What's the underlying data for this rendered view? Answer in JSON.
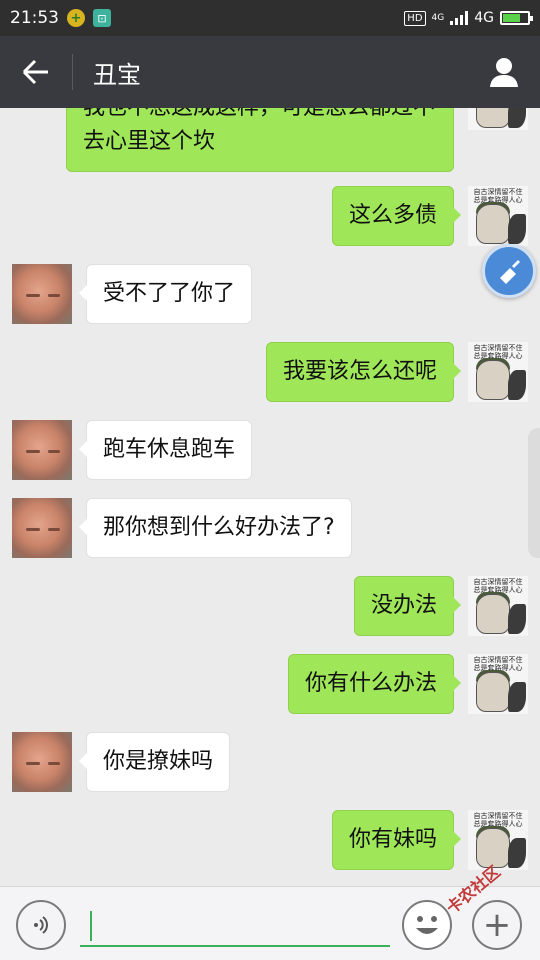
{
  "status_bar": {
    "time": "21:53",
    "hd": "HD",
    "network_small": "4G",
    "network": "4G",
    "battery_level": 0.7
  },
  "header": {
    "title": "丑宝",
    "back_icon": "arrow-left-icon",
    "profile_icon": "person-icon"
  },
  "meme_caption": "自古深情留不住 总是套路得人心",
  "messages": [
    {
      "side": "out",
      "text": "我也不想这成这样，可是怎么都过不去心里这个坎"
    },
    {
      "side": "out",
      "text": "这么多债"
    },
    {
      "side": "in",
      "text": "受不了了你了"
    },
    {
      "side": "out",
      "text": "我要该怎么还呢"
    },
    {
      "side": "in",
      "text": "跑车休息跑车"
    },
    {
      "side": "in",
      "text": "那你想到什么好办法了?"
    },
    {
      "side": "out",
      "text": "没办法"
    },
    {
      "side": "out",
      "text": "你有什么办法"
    },
    {
      "side": "in",
      "text": "你是撩妹吗"
    },
    {
      "side": "out",
      "text": "你有妹吗"
    }
  ],
  "input_bar": {
    "voice_icon": "voice-icon",
    "emoji_icon": "emoji-icon",
    "plus_icon": "plus-icon",
    "plus_label": "+"
  },
  "watermark": "卡农社区"
}
